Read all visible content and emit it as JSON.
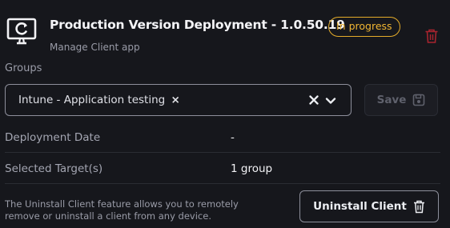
{
  "header": {
    "title": "Production Version Deployment - 1.0.50.19",
    "status": "In progress",
    "subtitle": "Manage Client app",
    "icon": "monitor-refresh-icon"
  },
  "groups": {
    "label": "Groups",
    "selected": [
      {
        "label": "Intune - Application testing",
        "remove": "×"
      }
    ],
    "save_label": "Save"
  },
  "details": [
    {
      "label": "Deployment Date",
      "value": "-"
    },
    {
      "label": "Selected Target(s)",
      "value": "1 group"
    }
  ],
  "uninstall": {
    "description": "The Uninstall Client feature allows you to remotely remove or uninstall a client from any device.",
    "button_label": "Uninstall Client"
  },
  "colors": {
    "background": "#16171c",
    "status_accent": "#e5ac2a",
    "danger": "#a8242e",
    "border": "#8d8f9b"
  }
}
